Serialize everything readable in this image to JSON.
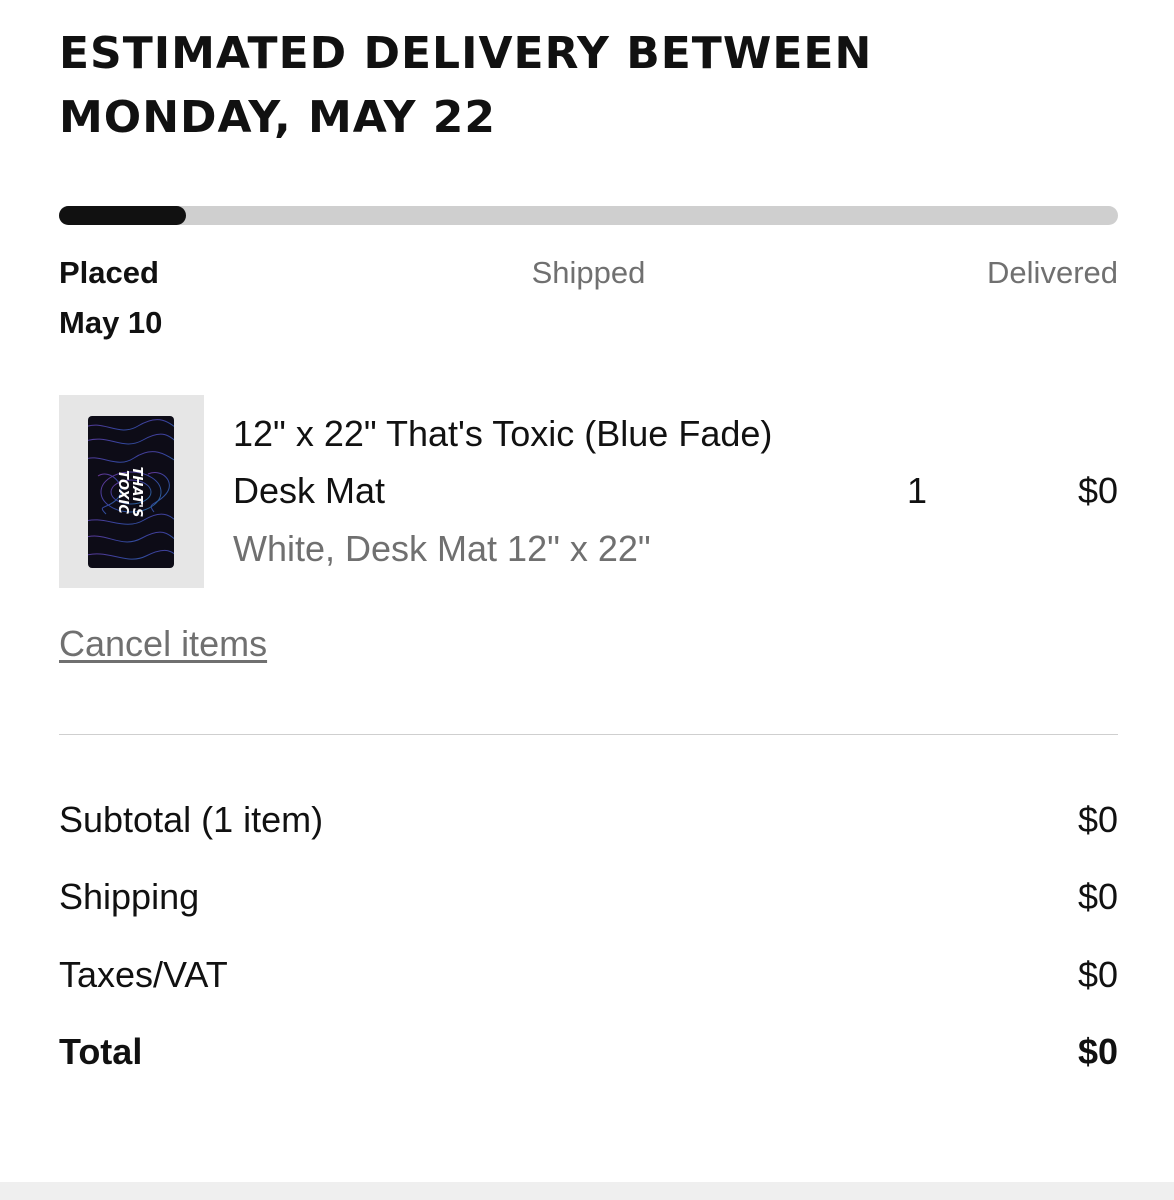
{
  "delivery": {
    "headline_line1": "ESTIMATED DELIVERY BETWEEN",
    "headline_line2": "MONDAY, MAY 22"
  },
  "progress": {
    "fraction": 0.12,
    "fill_color": "#111111",
    "track_color": "#cfcfcf",
    "steps": [
      {
        "label": "Placed",
        "date": "May 10",
        "active": true
      },
      {
        "label": "Shipped",
        "active": false
      },
      {
        "label": "Delivered",
        "active": false
      }
    ]
  },
  "item": {
    "title": "12\" x 22\" That's Toxic (Blue Fade) Desk Mat",
    "variant": "White, Desk Mat 12\" x 22\"",
    "quantity": "1",
    "price": "$0",
    "thumbnail_text": "THAT'S TOXIC"
  },
  "actions": {
    "cancel_label": "Cancel items"
  },
  "summary": {
    "subtotal_label": "Subtotal (1 item)",
    "subtotal_value": "$0",
    "shipping_label": "Shipping",
    "shipping_value": "$0",
    "taxes_label": "Taxes/VAT",
    "taxes_value": "$0",
    "total_label": "Total",
    "total_value": "$0"
  }
}
